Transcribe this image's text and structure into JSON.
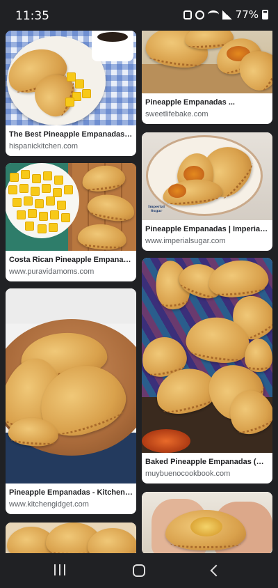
{
  "status_bar": {
    "time": "11:35",
    "battery": "77%"
  },
  "results": {
    "left": [
      {
        "title": "The Best Pineapple Empanadas Re...",
        "source": "hispanickitchen.com"
      },
      {
        "title": "Costa Rican Pineapple Empanadas...",
        "source": "www.puravidamoms.com"
      },
      {
        "title": "Pineapple Empanadas - Kitchen Gi...",
        "source": "www.kitchengidget.com"
      }
    ],
    "right": [
      {
        "title": "Pineapple Empanadas ...",
        "source": "sweetlifebake.com"
      },
      {
        "title": "Pineapple Empanadas | Imperial S...",
        "source": "www.imperialsugar.com"
      },
      {
        "title": "Baked Pineapple Empanadas (Mex...",
        "source": "muybuenocookbook.com"
      }
    ]
  },
  "image_captions": {
    "imperial_logo": "Imperial Sugar"
  }
}
